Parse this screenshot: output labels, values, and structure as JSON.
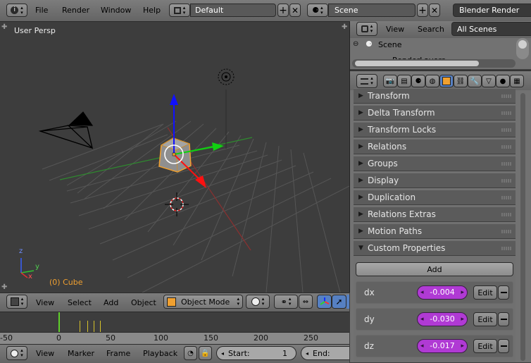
{
  "top_header": {
    "menus": [
      "File",
      "Render",
      "Window",
      "Help"
    ],
    "screen_layout": "Default",
    "scene": "Scene",
    "render_engine": "Blender Render"
  },
  "viewport": {
    "view_label": "User Persp",
    "object_label": "(0) Cube",
    "axis_labels": [
      "z",
      "y",
      "x"
    ],
    "header_menus": [
      "View",
      "Select",
      "Add",
      "Object"
    ],
    "mode": "Object Mode"
  },
  "timeline": {
    "ticks": [
      "-50",
      "0",
      "50",
      "100",
      "150",
      "200",
      "250"
    ],
    "header_menus": [
      "View",
      "Marker",
      "Frame",
      "Playback"
    ],
    "start_label": "Start:",
    "start_value": "1",
    "end_label": "End:"
  },
  "outliner": {
    "menus": [
      "View",
      "Search"
    ],
    "filter": "All Scenes",
    "tree": [
      "Scene",
      "RenderLayers"
    ]
  },
  "properties": {
    "panels": [
      "Transform",
      "Delta Transform",
      "Transform Locks",
      "Relations",
      "Groups",
      "Display",
      "Duplication",
      "Relations Extras",
      "Motion Paths"
    ],
    "open_panel": "Custom Properties",
    "add_button": "Add",
    "items": [
      {
        "name": "dx",
        "value": "-0.004",
        "edit": "Edit"
      },
      {
        "name": "dy",
        "value": "-0.030",
        "edit": "Edit"
      },
      {
        "name": "dz",
        "value": "-0.017",
        "edit": "Edit"
      }
    ]
  },
  "colors": {
    "accent_orange": "#f0a030",
    "property_purple": "#b03ad4",
    "active_tab_blue": "#5680c2"
  }
}
